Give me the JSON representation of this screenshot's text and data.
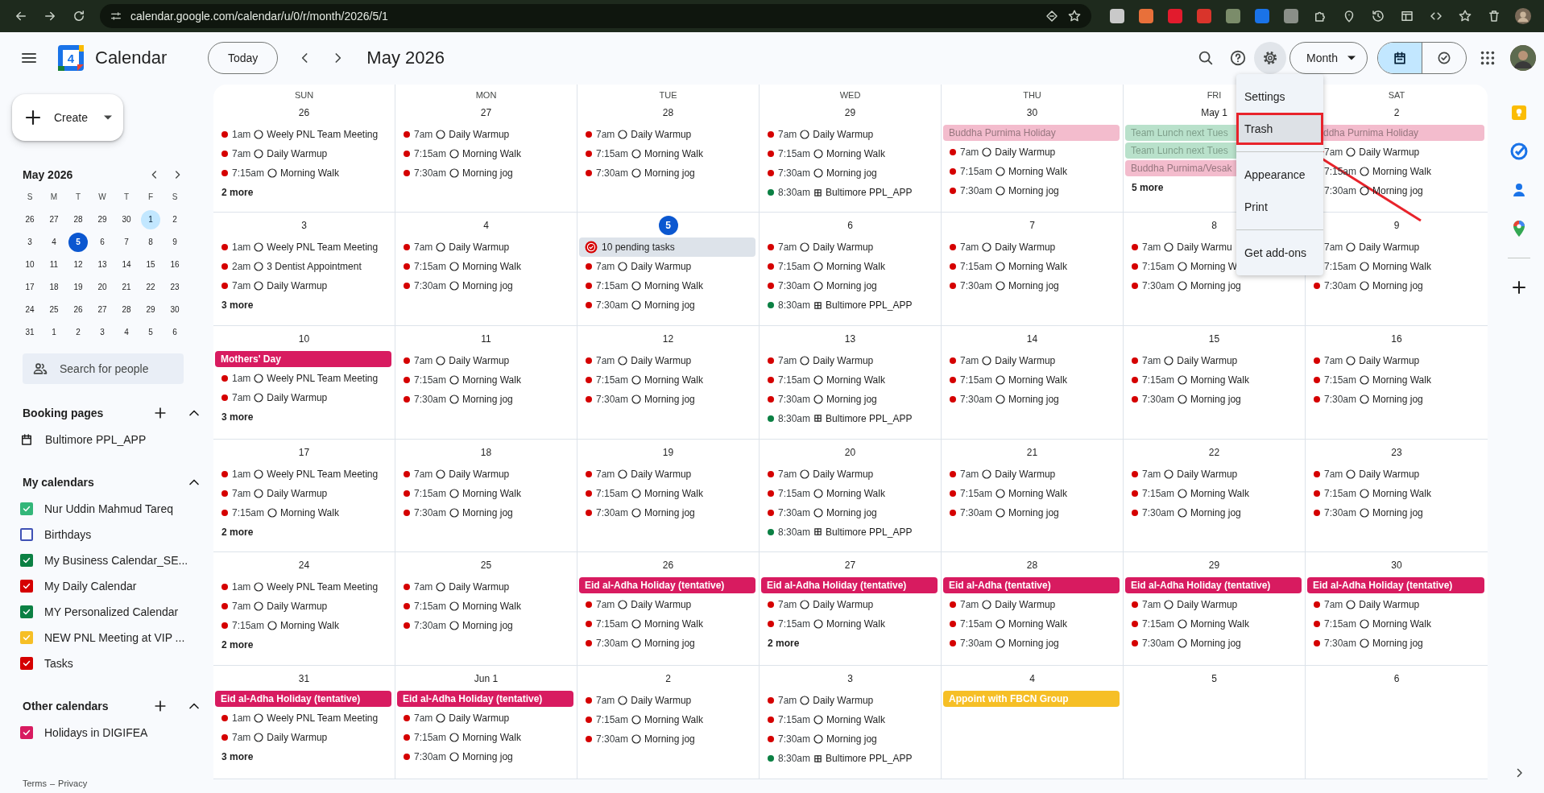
{
  "browser": {
    "url": "calendar.google.com/calendar/u/0/r/month/2026/5/1"
  },
  "header": {
    "logo_day": "4",
    "app_name": "Calendar",
    "today_button": "Today",
    "period": "May 2026",
    "view": "Month",
    "view_toggle": [
      {
        "kind": "calendar",
        "selected": true
      },
      {
        "kind": "tasks",
        "selected": false
      }
    ]
  },
  "sidebar": {
    "create": "Create",
    "mini_calendar": {
      "title": "May 2026",
      "weekdays": [
        "S",
        "M",
        "T",
        "W",
        "T",
        "F",
        "S"
      ],
      "weeks": [
        [
          {
            "d": "26",
            "selected": false,
            "today": false
          },
          {
            "d": "27",
            "selected": false,
            "today": false
          },
          {
            "d": "28",
            "selected": false,
            "today": false
          },
          {
            "d": "29",
            "selected": false,
            "today": false
          },
          {
            "d": "30",
            "selected": false,
            "today": false
          },
          {
            "d": "1",
            "selected": true,
            "today": false
          },
          {
            "d": "2",
            "selected": false,
            "today": false
          }
        ],
        [
          {
            "d": "3",
            "selected": false,
            "today": false
          },
          {
            "d": "4",
            "selected": false,
            "today": false
          },
          {
            "d": "5",
            "selected": false,
            "today": true
          },
          {
            "d": "6",
            "selected": false,
            "today": false
          },
          {
            "d": "7",
            "selected": false,
            "today": false
          },
          {
            "d": "8",
            "selected": false,
            "today": false
          },
          {
            "d": "9",
            "selected": false,
            "today": false
          }
        ],
        [
          {
            "d": "10",
            "selected": false,
            "today": false
          },
          {
            "d": "11",
            "selected": false,
            "today": false
          },
          {
            "d": "12",
            "selected": false,
            "today": false
          },
          {
            "d": "13",
            "selected": false,
            "today": false
          },
          {
            "d": "14",
            "selected": false,
            "today": false
          },
          {
            "d": "15",
            "selected": false,
            "today": false
          },
          {
            "d": "16",
            "selected": false,
            "today": false
          }
        ],
        [
          {
            "d": "17",
            "selected": false,
            "today": false
          },
          {
            "d": "18",
            "selected": false,
            "today": false
          },
          {
            "d": "19",
            "selected": false,
            "today": false
          },
          {
            "d": "20",
            "selected": false,
            "today": false
          },
          {
            "d": "21",
            "selected": false,
            "today": false
          },
          {
            "d": "22",
            "selected": false,
            "today": false
          },
          {
            "d": "23",
            "selected": false,
            "today": false
          }
        ],
        [
          {
            "d": "24",
            "selected": false,
            "today": false
          },
          {
            "d": "25",
            "selected": false,
            "today": false
          },
          {
            "d": "26",
            "selected": false,
            "today": false
          },
          {
            "d": "27",
            "selected": false,
            "today": false
          },
          {
            "d": "28",
            "selected": false,
            "today": false
          },
          {
            "d": "29",
            "selected": false,
            "today": false
          },
          {
            "d": "30",
            "selected": false,
            "today": false
          }
        ],
        [
          {
            "d": "31",
            "selected": false,
            "today": false
          },
          {
            "d": "1",
            "selected": false,
            "today": false
          },
          {
            "d": "2",
            "selected": false,
            "today": false
          },
          {
            "d": "3",
            "selected": false,
            "today": false
          },
          {
            "d": "4",
            "selected": false,
            "today": false
          },
          {
            "d": "5",
            "selected": false,
            "today": false
          },
          {
            "d": "6",
            "selected": false,
            "today": false
          }
        ]
      ]
    },
    "people_search": {
      "placeholder": "Search for people"
    },
    "booking_pages": {
      "title": "Booking pages",
      "items": [
        "Bultimore PPL_APP"
      ]
    },
    "my_calendars": {
      "title": "My calendars",
      "items": [
        {
          "name": "Nur Uddin Mahmud Tareq",
          "checked": true,
          "color": "#33b679"
        },
        {
          "name": "Birthdays",
          "checked": false,
          "color": "#3f51b5"
        },
        {
          "name": "My Business Calendar_SE...",
          "checked": true,
          "color": "#0b8043"
        },
        {
          "name": "My Daily Calendar",
          "checked": true,
          "color": "#d50000"
        },
        {
          "name": "MY Personalized Calendar",
          "checked": true,
          "color": "#0b8043"
        },
        {
          "name": "NEW PNL Meeting at VIP ...",
          "checked": true,
          "color": "#f6bf26"
        },
        {
          "name": "Tasks",
          "checked": true,
          "color": "#d50000"
        }
      ]
    },
    "other_calendars": {
      "title": "Other calendars",
      "items": [
        {
          "name": "Holidays in DIGIFEA",
          "checked": true,
          "color": "#d81b60"
        }
      ]
    },
    "footer": {
      "terms": "Terms",
      "separator": "–",
      "privacy": "Privacy"
    }
  },
  "month": {
    "weekdays": [
      "SUN",
      "MON",
      "TUE",
      "WED",
      "THU",
      "FRI",
      "SAT"
    ],
    "weeks": [
      {
        "days": [
          {
            "label": "26",
            "today": false,
            "events": [
              {
                "kind": "timed",
                "color": "#d50000",
                "time": "1am",
                "title": "Weely PNL Team Meeting"
              },
              {
                "kind": "timed",
                "color": "#d50000",
                "time": "7am",
                "title": "Daily Warmup"
              },
              {
                "kind": "timed",
                "color": "#d50000",
                "time": "7:15am",
                "title": "Morning Walk"
              },
              {
                "kind": "more",
                "title": "2 more"
              }
            ]
          },
          {
            "label": "27",
            "today": false,
            "events": [
              {
                "kind": "timed",
                "color": "#d50000",
                "time": "7am",
                "title": "Daily Warmup"
              },
              {
                "kind": "timed",
                "color": "#d50000",
                "time": "7:15am",
                "title": "Morning Walk"
              },
              {
                "kind": "timed",
                "color": "#d50000",
                "time": "7:30am",
                "title": "Morning jog"
              }
            ]
          },
          {
            "label": "28",
            "today": false,
            "events": [
              {
                "kind": "timed",
                "color": "#d50000",
                "time": "7am",
                "title": "Daily Warmup"
              },
              {
                "kind": "timed",
                "color": "#d50000",
                "time": "7:15am",
                "title": "Morning Walk"
              },
              {
                "kind": "timed",
                "color": "#d50000",
                "time": "7:30am",
                "title": "Morning jog"
              }
            ]
          },
          {
            "label": "29",
            "today": false,
            "events": [
              {
                "kind": "timed",
                "color": "#d50000",
                "time": "7am",
                "title": "Daily Warmup"
              },
              {
                "kind": "timed",
                "color": "#d50000",
                "time": "7:15am",
                "title": "Morning Walk"
              },
              {
                "kind": "timed",
                "color": "#d50000",
                "time": "7:30am",
                "title": "Morning jog"
              },
              {
                "kind": "appointment",
                "color": "#0b8043",
                "time": "8:30am",
                "title": "Bultimore PPL_APP"
              }
            ]
          },
          {
            "label": "30",
            "today": false,
            "events": [
              {
                "kind": "allday",
                "color": "#f3bccd",
                "past": true,
                "title": "Buddha Purnima Holiday"
              },
              {
                "kind": "timed",
                "color": "#d50000",
                "time": "7am",
                "title": "Daily Warmup"
              },
              {
                "kind": "timed",
                "color": "#d50000",
                "time": "7:15am",
                "title": "Morning Walk"
              },
              {
                "kind": "timed",
                "color": "#d50000",
                "time": "7:30am",
                "title": "Morning jog"
              }
            ]
          },
          {
            "label": "May 1",
            "today": false,
            "events": [
              {
                "kind": "allday",
                "color": "#b9e1cb",
                "past": true,
                "title": "Team Lunch next Tues"
              },
              {
                "kind": "allday",
                "color": "#b9e1cb",
                "past": true,
                "title": "Team Lunch next Tues"
              },
              {
                "kind": "allday",
                "color": "#f3bccd",
                "past": true,
                "title": "Buddha Purnima/Vesak"
              },
              {
                "kind": "more",
                "title": "5 more"
              }
            ]
          },
          {
            "label": "2",
            "today": false,
            "events": [
              {
                "kind": "allday",
                "color": "#f3bccd",
                "past": true,
                "cut_start": true,
                "title": "ddha Purnima Holiday"
              },
              {
                "kind": "timed",
                "time": "7am",
                "title": "Daily Warmup"
              },
              {
                "kind": "timed",
                "time": "7:15am",
                "title": "Morning Walk"
              },
              {
                "kind": "timed",
                "time": "7:30am",
                "title": "Morning jog"
              }
            ]
          }
        ]
      },
      {
        "days": [
          {
            "label": "3",
            "today": false,
            "events": [
              {
                "kind": "timed",
                "color": "#d50000",
                "time": "1am",
                "title": "Weely PNL Team Meeting"
              },
              {
                "kind": "timed",
                "color": "#d50000",
                "time": "2am",
                "title": "3 Dentist Appointment"
              },
              {
                "kind": "timed",
                "color": "#d50000",
                "time": "7am",
                "title": "Daily Warmup"
              },
              {
                "kind": "more",
                "title": "3 more"
              }
            ]
          },
          {
            "label": "4",
            "today": false,
            "events": [
              {
                "kind": "timed",
                "color": "#d50000",
                "time": "7am",
                "title": "Daily Warmup"
              },
              {
                "kind": "timed",
                "color": "#d50000",
                "time": "7:15am",
                "title": "Morning Walk"
              },
              {
                "kind": "timed",
                "color": "#d50000",
                "time": "7:30am",
                "title": "Morning jog"
              }
            ]
          },
          {
            "label": "5",
            "today": true,
            "events": [
              {
                "kind": "tasks",
                "title": "10 pending tasks"
              },
              {
                "kind": "timed",
                "color": "#d50000",
                "time": "7am",
                "title": "Daily Warmup"
              },
              {
                "kind": "timed",
                "color": "#d50000",
                "time": "7:15am",
                "title": "Morning Walk"
              },
              {
                "kind": "timed",
                "color": "#d50000",
                "time": "7:30am",
                "title": "Morning jog"
              }
            ]
          },
          {
            "label": "6",
            "today": false,
            "events": [
              {
                "kind": "timed",
                "color": "#d50000",
                "time": "7am",
                "title": "Daily Warmup"
              },
              {
                "kind": "timed",
                "color": "#d50000",
                "time": "7:15am",
                "title": "Morning Walk"
              },
              {
                "kind": "timed",
                "color": "#d50000",
                "time": "7:30am",
                "title": "Morning jog"
              },
              {
                "kind": "appointment",
                "color": "#0b8043",
                "time": "8:30am",
                "title": "Bultimore PPL_APP"
              }
            ]
          },
          {
            "label": "7",
            "today": false,
            "events": [
              {
                "kind": "timed",
                "color": "#d50000",
                "time": "7am",
                "title": "Daily Warmup"
              },
              {
                "kind": "timed",
                "color": "#d50000",
                "time": "7:15am",
                "title": "Morning Walk"
              },
              {
                "kind": "timed",
                "color": "#d50000",
                "time": "7:30am",
                "title": "Morning jog"
              }
            ]
          },
          {
            "label": "8",
            "today": false,
            "events": [
              {
                "kind": "timed",
                "color": "#d50000",
                "time": "7am",
                "title": "Daily Warmu"
              },
              {
                "kind": "timed",
                "color": "#d50000",
                "time": "7:15am",
                "title": "Morning W"
              },
              {
                "kind": "timed",
                "color": "#d50000",
                "time": "7:30am",
                "title": "Morning jog"
              }
            ]
          },
          {
            "label": "9",
            "today": false,
            "events": [
              {
                "kind": "timed",
                "time": "7am",
                "title": "Daily Warmup"
              },
              {
                "kind": "timed",
                "time": "7:15am",
                "title": "Morning Walk"
              },
              {
                "kind": "timed",
                "color": "#d50000",
                "time": "7:30am",
                "title": "Morning jog"
              }
            ]
          }
        ]
      },
      {
        "days": [
          {
            "label": "10",
            "today": false,
            "events": [
              {
                "kind": "allday",
                "color": "#d81b60",
                "past": false,
                "title": "Mothers' Day"
              },
              {
                "kind": "timed",
                "color": "#d50000",
                "time": "1am",
                "title": "Weely PNL Team Meeting"
              },
              {
                "kind": "timed",
                "color": "#d50000",
                "time": "7am",
                "title": "Daily Warmup"
              },
              {
                "kind": "more",
                "title": "3 more"
              }
            ]
          },
          {
            "label": "11",
            "today": false,
            "events": [
              {
                "kind": "timed",
                "color": "#d50000",
                "time": "7am",
                "title": "Daily Warmup"
              },
              {
                "kind": "timed",
                "color": "#d50000",
                "time": "7:15am",
                "title": "Morning Walk"
              },
              {
                "kind": "timed",
                "color": "#d50000",
                "time": "7:30am",
                "title": "Morning jog"
              }
            ]
          },
          {
            "label": "12",
            "today": false,
            "events": [
              {
                "kind": "timed",
                "color": "#d50000",
                "time": "7am",
                "title": "Daily Warmup"
              },
              {
                "kind": "timed",
                "color": "#d50000",
                "time": "7:15am",
                "title": "Morning Walk"
              },
              {
                "kind": "timed",
                "color": "#d50000",
                "time": "7:30am",
                "title": "Morning jog"
              }
            ]
          },
          {
            "label": "13",
            "today": false,
            "events": [
              {
                "kind": "timed",
                "color": "#d50000",
                "time": "7am",
                "title": "Daily Warmup"
              },
              {
                "kind": "timed",
                "color": "#d50000",
                "time": "7:15am",
                "title": "Morning Walk"
              },
              {
                "kind": "timed",
                "color": "#d50000",
                "time": "7:30am",
                "title": "Morning jog"
              },
              {
                "kind": "appointment",
                "color": "#0b8043",
                "time": "8:30am",
                "title": "Bultimore PPL_APP"
              }
            ]
          },
          {
            "label": "14",
            "today": false,
            "events": [
              {
                "kind": "timed",
                "color": "#d50000",
                "time": "7am",
                "title": "Daily Warmup"
              },
              {
                "kind": "timed",
                "color": "#d50000",
                "time": "7:15am",
                "title": "Morning Walk"
              },
              {
                "kind": "timed",
                "color": "#d50000",
                "time": "7:30am",
                "title": "Morning jog"
              }
            ]
          },
          {
            "label": "15",
            "today": false,
            "events": [
              {
                "kind": "timed",
                "color": "#d50000",
                "time": "7am",
                "title": "Daily Warmup"
              },
              {
                "kind": "timed",
                "color": "#d50000",
                "time": "7:15am",
                "title": "Morning Walk"
              },
              {
                "kind": "timed",
                "color": "#d50000",
                "time": "7:30am",
                "title": "Morning jog"
              }
            ]
          },
          {
            "label": "16",
            "today": false,
            "events": [
              {
                "kind": "timed",
                "color": "#d50000",
                "time": "7am",
                "title": "Daily Warmup"
              },
              {
                "kind": "timed",
                "color": "#d50000",
                "time": "7:15am",
                "title": "Morning Walk"
              },
              {
                "kind": "timed",
                "color": "#d50000",
                "time": "7:30am",
                "title": "Morning jog"
              }
            ]
          }
        ]
      },
      {
        "days": [
          {
            "label": "17",
            "today": false,
            "events": [
              {
                "kind": "timed",
                "color": "#d50000",
                "time": "1am",
                "title": "Weely PNL Team Meeting"
              },
              {
                "kind": "timed",
                "color": "#d50000",
                "time": "7am",
                "title": "Daily Warmup"
              },
              {
                "kind": "timed",
                "color": "#d50000",
                "time": "7:15am",
                "title": "Morning Walk"
              },
              {
                "kind": "more",
                "title": "2 more"
              }
            ]
          },
          {
            "label": "18",
            "today": false,
            "events": [
              {
                "kind": "timed",
                "color": "#d50000",
                "time": "7am",
                "title": "Daily Warmup"
              },
              {
                "kind": "timed",
                "color": "#d50000",
                "time": "7:15am",
                "title": "Morning Walk"
              },
              {
                "kind": "timed",
                "color": "#d50000",
                "time": "7:30am",
                "title": "Morning jog"
              }
            ]
          },
          {
            "label": "19",
            "today": false,
            "events": [
              {
                "kind": "timed",
                "color": "#d50000",
                "time": "7am",
                "title": "Daily Warmup"
              },
              {
                "kind": "timed",
                "color": "#d50000",
                "time": "7:15am",
                "title": "Morning Walk"
              },
              {
                "kind": "timed",
                "color": "#d50000",
                "time": "7:30am",
                "title": "Morning jog"
              }
            ]
          },
          {
            "label": "20",
            "today": false,
            "events": [
              {
                "kind": "timed",
                "color": "#d50000",
                "time": "7am",
                "title": "Daily Warmup"
              },
              {
                "kind": "timed",
                "color": "#d50000",
                "time": "7:15am",
                "title": "Morning Walk"
              },
              {
                "kind": "timed",
                "color": "#d50000",
                "time": "7:30am",
                "title": "Morning jog"
              },
              {
                "kind": "appointment",
                "color": "#0b8043",
                "time": "8:30am",
                "title": "Bultimore PPL_APP"
              }
            ]
          },
          {
            "label": "21",
            "today": false,
            "events": [
              {
                "kind": "timed",
                "color": "#d50000",
                "time": "7am",
                "title": "Daily Warmup"
              },
              {
                "kind": "timed",
                "color": "#d50000",
                "time": "7:15am",
                "title": "Morning Walk"
              },
              {
                "kind": "timed",
                "color": "#d50000",
                "time": "7:30am",
                "title": "Morning jog"
              }
            ]
          },
          {
            "label": "22",
            "today": false,
            "events": [
              {
                "kind": "timed",
                "color": "#d50000",
                "time": "7am",
                "title": "Daily Warmup"
              },
              {
                "kind": "timed",
                "color": "#d50000",
                "time": "7:15am",
                "title": "Morning Walk"
              },
              {
                "kind": "timed",
                "color": "#d50000",
                "time": "7:30am",
                "title": "Morning jog"
              }
            ]
          },
          {
            "label": "23",
            "today": false,
            "events": [
              {
                "kind": "timed",
                "color": "#d50000",
                "time": "7am",
                "title": "Daily Warmup"
              },
              {
                "kind": "timed",
                "color": "#d50000",
                "time": "7:15am",
                "title": "Morning Walk"
              },
              {
                "kind": "timed",
                "color": "#d50000",
                "time": "7:30am",
                "title": "Morning jog"
              }
            ]
          }
        ]
      },
      {
        "days": [
          {
            "label": "24",
            "today": false,
            "events": [
              {
                "kind": "timed",
                "color": "#d50000",
                "time": "1am",
                "title": "Weely PNL Team Meeting"
              },
              {
                "kind": "timed",
                "color": "#d50000",
                "time": "7am",
                "title": "Daily Warmup"
              },
              {
                "kind": "timed",
                "color": "#d50000",
                "time": "7:15am",
                "title": "Morning Walk"
              },
              {
                "kind": "more",
                "title": "2 more"
              }
            ]
          },
          {
            "label": "25",
            "today": false,
            "events": [
              {
                "kind": "timed",
                "color": "#d50000",
                "time": "7am",
                "title": "Daily Warmup"
              },
              {
                "kind": "timed",
                "color": "#d50000",
                "time": "7:15am",
                "title": "Morning Walk"
              },
              {
                "kind": "timed",
                "color": "#d50000",
                "time": "7:30am",
                "title": "Morning jog"
              }
            ]
          },
          {
            "label": "26",
            "today": false,
            "events": [
              {
                "kind": "allday",
                "color": "#d81b60",
                "past": false,
                "title": "Eid al-Adha Holiday (tentative)"
              },
              {
                "kind": "timed",
                "color": "#d50000",
                "time": "7am",
                "title": "Daily Warmup"
              },
              {
                "kind": "timed",
                "color": "#d50000",
                "time": "7:15am",
                "title": "Morning Walk"
              },
              {
                "kind": "timed",
                "color": "#d50000",
                "time": "7:30am",
                "title": "Morning jog"
              }
            ]
          },
          {
            "label": "27",
            "today": false,
            "events": [
              {
                "kind": "allday",
                "color": "#d81b60",
                "past": false,
                "title": "Eid al-Adha Holiday (tentative)"
              },
              {
                "kind": "timed",
                "color": "#d50000",
                "time": "7am",
                "title": "Daily Warmup"
              },
              {
                "kind": "timed",
                "color": "#d50000",
                "time": "7:15am",
                "title": "Morning Walk"
              },
              {
                "kind": "more",
                "title": "2 more"
              }
            ]
          },
          {
            "label": "28",
            "today": false,
            "events": [
              {
                "kind": "allday",
                "color": "#d81b60",
                "past": false,
                "title": "Eid al-Adha (tentative)"
              },
              {
                "kind": "timed",
                "color": "#d50000",
                "time": "7am",
                "title": "Daily Warmup"
              },
              {
                "kind": "timed",
                "color": "#d50000",
                "time": "7:15am",
                "title": "Morning Walk"
              },
              {
                "kind": "timed",
                "color": "#d50000",
                "time": "7:30am",
                "title": "Morning jog"
              }
            ]
          },
          {
            "label": "29",
            "today": false,
            "events": [
              {
                "kind": "allday",
                "color": "#d81b60",
                "past": false,
                "title": "Eid al-Adha Holiday (tentative)"
              },
              {
                "kind": "timed",
                "color": "#d50000",
                "time": "7am",
                "title": "Daily Warmup"
              },
              {
                "kind": "timed",
                "color": "#d50000",
                "time": "7:15am",
                "title": "Morning Walk"
              },
              {
                "kind": "timed",
                "color": "#d50000",
                "time": "7:30am",
                "title": "Morning jog"
              }
            ]
          },
          {
            "label": "30",
            "today": false,
            "events": [
              {
                "kind": "allday",
                "color": "#d81b60",
                "past": false,
                "title": "Eid al-Adha Holiday (tentative)"
              },
              {
                "kind": "timed",
                "color": "#d50000",
                "time": "7am",
                "title": "Daily Warmup"
              },
              {
                "kind": "timed",
                "color": "#d50000",
                "time": "7:15am",
                "title": "Morning Walk"
              },
              {
                "kind": "timed",
                "color": "#d50000",
                "time": "7:30am",
                "title": "Morning jog"
              }
            ]
          }
        ]
      },
      {
        "days": [
          {
            "label": "31",
            "today": false,
            "events": [
              {
                "kind": "allday",
                "color": "#d81b60",
                "past": false,
                "title": "Eid al-Adha Holiday (tentative)"
              },
              {
                "kind": "timed",
                "color": "#d50000",
                "time": "1am",
                "title": "Weely PNL Team Meeting"
              },
              {
                "kind": "timed",
                "color": "#d50000",
                "time": "7am",
                "title": "Daily Warmup"
              },
              {
                "kind": "more",
                "title": "3 more"
              }
            ]
          },
          {
            "label": "Jun 1",
            "today": false,
            "events": [
              {
                "kind": "allday",
                "color": "#d81b60",
                "past": false,
                "title": "Eid al-Adha Holiday (tentative)"
              },
              {
                "kind": "timed",
                "color": "#d50000",
                "time": "7am",
                "title": "Daily Warmup"
              },
              {
                "kind": "timed",
                "color": "#d50000",
                "time": "7:15am",
                "title": "Morning Walk"
              },
              {
                "kind": "timed",
                "color": "#d50000",
                "time": "7:30am",
                "title": "Morning jog"
              }
            ]
          },
          {
            "label": "2",
            "today": false,
            "events": [
              {
                "kind": "timed",
                "color": "#d50000",
                "time": "7am",
                "title": "Daily Warmup"
              },
              {
                "kind": "timed",
                "color": "#d50000",
                "time": "7:15am",
                "title": "Morning Walk"
              },
              {
                "kind": "timed",
                "color": "#d50000",
                "time": "7:30am",
                "title": "Morning jog"
              }
            ]
          },
          {
            "label": "3",
            "today": false,
            "events": [
              {
                "kind": "timed",
                "color": "#d50000",
                "time": "7am",
                "title": "Daily Warmup"
              },
              {
                "kind": "timed",
                "color": "#d50000",
                "time": "7:15am",
                "title": "Morning Walk"
              },
              {
                "kind": "timed",
                "color": "#d50000",
                "time": "7:30am",
                "title": "Morning jog"
              },
              {
                "kind": "appointment",
                "color": "#0b8043",
                "time": "8:30am",
                "title": "Bultimore PPL_APP"
              }
            ]
          },
          {
            "label": "4",
            "today": false,
            "events": [
              {
                "kind": "allday",
                "color": "#f6bf26",
                "past": false,
                "title": "Appoint with FBCN Group"
              }
            ]
          },
          {
            "label": "5",
            "today": false
          },
          {
            "label": "6",
            "today": false
          }
        ]
      }
    ]
  },
  "settings_menu": {
    "groups": [
      [
        {
          "label": "Settings",
          "selected": false,
          "annotated": false
        },
        {
          "label": "Trash",
          "selected": true,
          "annotated": true
        }
      ],
      [
        {
          "label": "Appearance",
          "selected": false,
          "annotated": false
        },
        {
          "label": "Print",
          "selected": false,
          "annotated": false
        }
      ],
      [
        {
          "label": "Get add-ons",
          "selected": false,
          "annotated": false
        }
      ]
    ]
  }
}
